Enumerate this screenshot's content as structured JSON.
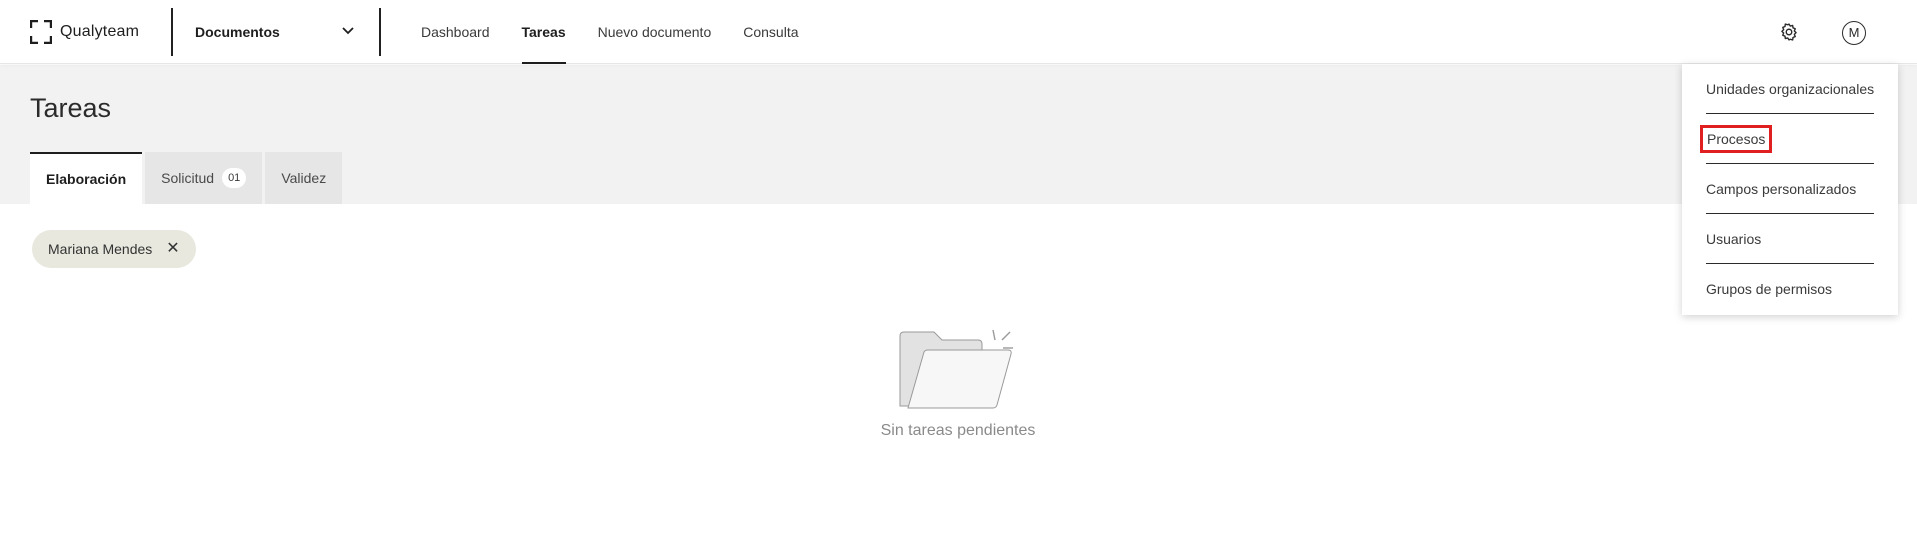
{
  "app": {
    "logo_text": "Qualyteam"
  },
  "module_selector": {
    "value": "Documentos"
  },
  "nav": {
    "items": [
      {
        "label": "Dashboard"
      },
      {
        "label": "Tareas"
      },
      {
        "label": "Nuevo documento"
      },
      {
        "label": "Consulta"
      }
    ],
    "active": "Tareas"
  },
  "user": {
    "avatar_initial": "M"
  },
  "page": {
    "title": "Tareas"
  },
  "tabs": [
    {
      "label": "Elaboración"
    },
    {
      "label": "Solicitud",
      "badge": "01"
    },
    {
      "label": "Validez"
    }
  ],
  "filter_chip": {
    "label": "Mariana Mendes",
    "close_glyph": "✕"
  },
  "empty_state": {
    "text": "Sin tareas pendientes"
  },
  "settings_menu": {
    "items": [
      {
        "label": "Unidades organizacionales"
      },
      {
        "label": "Procesos"
      },
      {
        "label": "Campos personalizados"
      },
      {
        "label": "Usuarios"
      },
      {
        "label": "Grupos de permisos"
      }
    ],
    "highlighted": "Procesos"
  },
  "icons": {
    "logo": "logo-icon",
    "dropdown": "chevron-down-icon",
    "settings": "gear-icon",
    "empty": "empty-folder-icon"
  },
  "colors": {
    "highlight_outline": "#e02020",
    "header_bg": "#f2f2f2",
    "chip_bg": "#e8e8df",
    "text_dark": "#1e1e1e"
  }
}
